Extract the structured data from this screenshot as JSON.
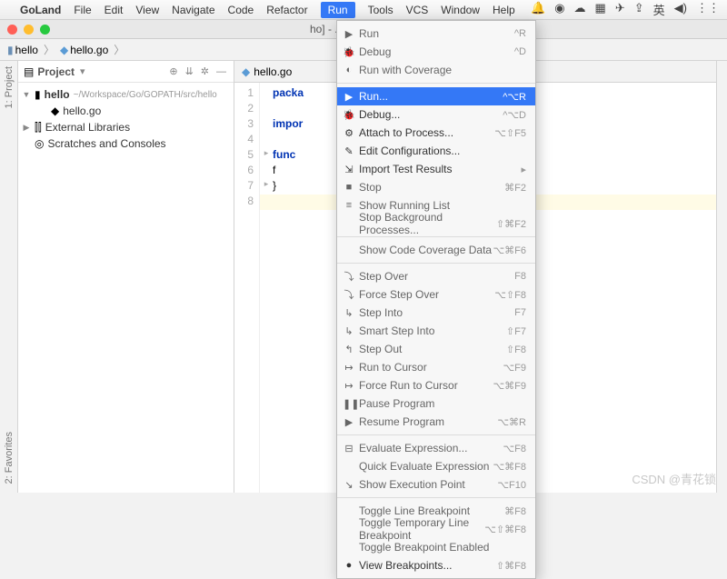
{
  "menubar": {
    "app": "GoLand",
    "items": [
      "File",
      "Edit",
      "View",
      "Navigate",
      "Code",
      "Refactor",
      "Run",
      "Tools",
      "VCS",
      "Window",
      "Help"
    ],
    "active": "Run",
    "right_icons": [
      "bell",
      "user",
      "wechat",
      "grid",
      "plane",
      "up",
      "kanji",
      "volume",
      "wifi"
    ]
  },
  "window_title": "ho] - .../hello.go [hello]",
  "breadcrumbs": [
    {
      "icon": "folder",
      "label": "hello"
    },
    {
      "icon": "go",
      "label": "hello.go"
    }
  ],
  "project": {
    "title": "Project",
    "header_icons": [
      "dropdown",
      "target",
      "collapse",
      "gear",
      "hide"
    ],
    "tree": [
      {
        "expand": "▼",
        "icon": "folder",
        "label": "hello",
        "path": "~/Workspace/Go/GOPATH/src/hello",
        "bold": true,
        "depth": 0
      },
      {
        "expand": "",
        "icon": "go",
        "label": "hello.go",
        "depth": 1
      },
      {
        "expand": "▶",
        "icon": "lib",
        "label": "External Libraries",
        "depth": 0
      },
      {
        "expand": "",
        "icon": "scratch",
        "label": "Scratches and Consoles",
        "depth": 0
      }
    ]
  },
  "left_tool_labels": [
    "1: Project",
    "2: Favorites"
  ],
  "editor": {
    "tab": {
      "icon": "go",
      "label": "hello.go"
    },
    "lines": [
      {
        "n": 1,
        "fold": "",
        "text": "packa"
      },
      {
        "n": 2,
        "fold": "",
        "text": ""
      },
      {
        "n": 3,
        "fold": "",
        "text": "impor"
      },
      {
        "n": 4,
        "fold": "",
        "text": ""
      },
      {
        "n": 5,
        "fold": "▸",
        "text": "func "
      },
      {
        "n": 6,
        "fold": "",
        "text": "    f"
      },
      {
        "n": 7,
        "fold": "▸",
        "text": "}"
      },
      {
        "n": 8,
        "fold": "",
        "text": ""
      }
    ]
  },
  "run_menu": [
    {
      "icon": "▶",
      "label": "Run",
      "sc": "^R",
      "enabled": false
    },
    {
      "icon": "🐞",
      "label": "Debug",
      "sc": "^D",
      "enabled": false
    },
    {
      "icon": "◐",
      "label": "Run with Coverage",
      "enabled": false
    },
    {
      "sep": true
    },
    {
      "icon": "▶",
      "label": "Run...",
      "sc": "^⌥R",
      "enabled": true,
      "highlight": true
    },
    {
      "icon": "🐞",
      "label": "Debug...",
      "sc": "^⌥D",
      "enabled": true
    },
    {
      "icon": "⚙",
      "label": "Attach to Process...",
      "sc": "⌥⇧F5",
      "enabled": true
    },
    {
      "icon": "✎",
      "label": "Edit Configurations...",
      "enabled": true
    },
    {
      "icon": "⇲",
      "label": "Import Test Results",
      "sub": true,
      "enabled": true
    },
    {
      "icon": "■",
      "label": "Stop",
      "sc": "⌘F2",
      "enabled": false
    },
    {
      "icon": "≡",
      "label": "Show Running List",
      "enabled": false
    },
    {
      "label": "Stop Background Processes...",
      "sc": "⇧⌘F2",
      "enabled": false
    },
    {
      "sep": true
    },
    {
      "label": "Show Code Coverage Data",
      "sc": "⌥⌘F6",
      "enabled": false
    },
    {
      "sep": true
    },
    {
      "icon": "⤵",
      "label": "Step Over",
      "sc": "F8",
      "enabled": false
    },
    {
      "icon": "⤵",
      "label": "Force Step Over",
      "sc": "⌥⇧F8",
      "enabled": false
    },
    {
      "icon": "↳",
      "label": "Step Into",
      "sc": "F7",
      "enabled": false
    },
    {
      "icon": "↳",
      "label": "Smart Step Into",
      "sc": "⇧F7",
      "enabled": false
    },
    {
      "icon": "↰",
      "label": "Step Out",
      "sc": "⇧F8",
      "enabled": false
    },
    {
      "icon": "↦",
      "label": "Run to Cursor",
      "sc": "⌥F9",
      "enabled": false
    },
    {
      "icon": "↦",
      "label": "Force Run to Cursor",
      "sc": "⌥⌘F9",
      "enabled": false
    },
    {
      "icon": "❚❚",
      "label": "Pause Program",
      "enabled": false
    },
    {
      "icon": "▶",
      "label": "Resume Program",
      "sc": "⌥⌘R",
      "enabled": false
    },
    {
      "sep": true
    },
    {
      "icon": "⊟",
      "label": "Evaluate Expression...",
      "sc": "⌥F8",
      "enabled": false
    },
    {
      "label": "Quick Evaluate Expression",
      "sc": "⌥⌘F8",
      "enabled": false
    },
    {
      "icon": "↘",
      "label": "Show Execution Point",
      "sc": "⌥F10",
      "enabled": false
    },
    {
      "sep": true
    },
    {
      "label": "Toggle Line Breakpoint",
      "sc": "⌘F8",
      "enabled": false
    },
    {
      "label": "Toggle Temporary Line Breakpoint",
      "sc": "⌥⇧⌘F8",
      "enabled": false
    },
    {
      "label": "Toggle Breakpoint Enabled",
      "enabled": false
    },
    {
      "icon": "●",
      "label": "View Breakpoints...",
      "sc": "⇧⌘F8",
      "enabled": true
    }
  ],
  "watermark": "CSDN @青花锁"
}
